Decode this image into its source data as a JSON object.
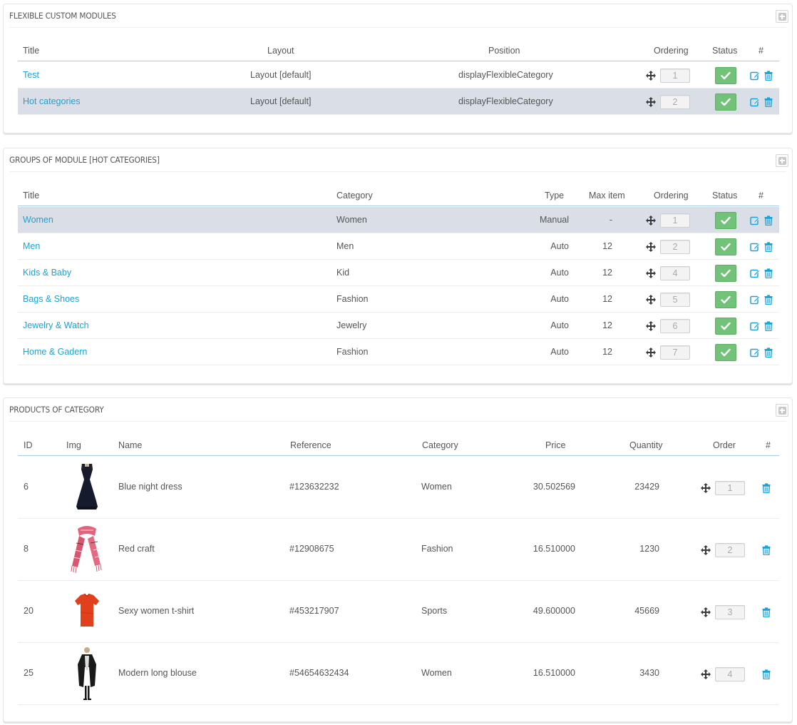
{
  "colors": {
    "link": "#1aa3d7",
    "status_on": "#72c279",
    "row_highlight": "#d9dee7"
  },
  "flexible": {
    "title": "FLEXIBLE CUSTOM MODULES",
    "headers": {
      "title": "Title",
      "layout": "Layout",
      "position": "Position",
      "ordering": "Ordering",
      "status": "Status",
      "actions": "#"
    },
    "rows": [
      {
        "title": "Test",
        "layout": "Layout [default]",
        "position": "displayFlexibleCategory",
        "order": "1",
        "active": false
      },
      {
        "title": "Hot categories",
        "layout": "Layout [default]",
        "position": "displayFlexibleCategory",
        "order": "2",
        "active": true
      }
    ]
  },
  "groups": {
    "title": "GROUPS OF MODULE [HOT CATEGORIES]",
    "headers": {
      "title": "Title",
      "category": "Category",
      "type": "Type",
      "max": "Max item",
      "ordering": "Ordering",
      "status": "Status",
      "actions": "#"
    },
    "rows": [
      {
        "title": "Women",
        "category": "Women",
        "type": "Manual",
        "max": "-",
        "order": "1",
        "active": true
      },
      {
        "title": "Men",
        "category": "Men",
        "type": "Auto",
        "max": "12",
        "order": "2",
        "active": false
      },
      {
        "title": "Kids & Baby",
        "category": "Kid",
        "type": "Auto",
        "max": "12",
        "order": "4",
        "active": false
      },
      {
        "title": "Bags & Shoes",
        "category": "Fashion",
        "type": "Auto",
        "max": "12",
        "order": "5",
        "active": false
      },
      {
        "title": "Jewelry & Watch",
        "category": "Jewelry",
        "type": "Auto",
        "max": "12",
        "order": "6",
        "active": false
      },
      {
        "title": "Home & Gadern",
        "category": "Fashion",
        "type": "Auto",
        "max": "12",
        "order": "7",
        "active": false
      }
    ]
  },
  "products": {
    "title": "PRODUCTS OF CATEGORY",
    "headers": {
      "id": "ID",
      "img": "Img",
      "name": "Name",
      "reference": "Reference",
      "category": "Category",
      "price": "Price",
      "quantity": "Quantity",
      "order": "Order",
      "actions": "#"
    },
    "rows": [
      {
        "id": "6",
        "name": "Blue night dress",
        "reference": "#123632232",
        "category": "Women",
        "price": "30.502569",
        "quantity": "23429",
        "order": "1",
        "image": "dress-image"
      },
      {
        "id": "8",
        "name": "Red craft",
        "reference": "#12908675",
        "category": "Fashion",
        "price": "16.510000",
        "quantity": "1230",
        "order": "2",
        "image": "scarf-image"
      },
      {
        "id": "20",
        "name": "Sexy women t-shirt",
        "reference": "#453217907",
        "category": "Sports",
        "price": "49.600000",
        "quantity": "45669",
        "order": "3",
        "image": "tshirt-image"
      },
      {
        "id": "25",
        "name": "Modern long blouse",
        "reference": "#54654632434",
        "category": "Women",
        "price": "16.510000",
        "quantity": "3430",
        "order": "4",
        "image": "blouse-image"
      }
    ]
  }
}
